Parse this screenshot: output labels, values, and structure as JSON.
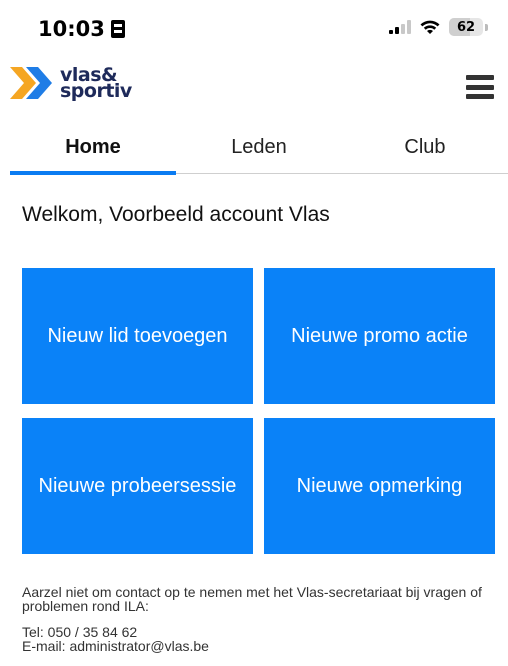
{
  "status_bar": {
    "time": "10:03",
    "battery_level": "62",
    "battery_fraction": 0.62,
    "icons": [
      "focus-mode-icon",
      "signal-icon",
      "wifi-icon",
      "battery-icon"
    ]
  },
  "header": {
    "logo_line1": "vlas&",
    "logo_line2": "sportiv",
    "logo_colors": {
      "chevron_orange": "#f5a623",
      "chevron_blue": "#1f7de6",
      "text": "#1e2a5a"
    },
    "menu_icon": "hamburger-menu-icon"
  },
  "tabs": [
    {
      "label": "Home",
      "active": true
    },
    {
      "label": "Leden",
      "active": false
    },
    {
      "label": "Club",
      "active": false
    }
  ],
  "welcome": "Welkom, Voorbeeld account Vlas",
  "tiles": [
    {
      "label": "Nieuw lid toevoegen"
    },
    {
      "label": "Nieuwe promo actie"
    },
    {
      "label": "Nieuwe probeersessie"
    },
    {
      "label": "Nieuwe opmerking"
    }
  ],
  "footer": {
    "message": "Aarzel niet om contact op te nemen met het Vlas-secretariaat bij vragen of problemen rond ILA:",
    "tel": "Tel: 050 / 35 84 62",
    "email": "E-mail: administrator@vlas.be"
  },
  "colors": {
    "accent": "#0a82f8",
    "tab_underline": "#0a7cf2"
  }
}
